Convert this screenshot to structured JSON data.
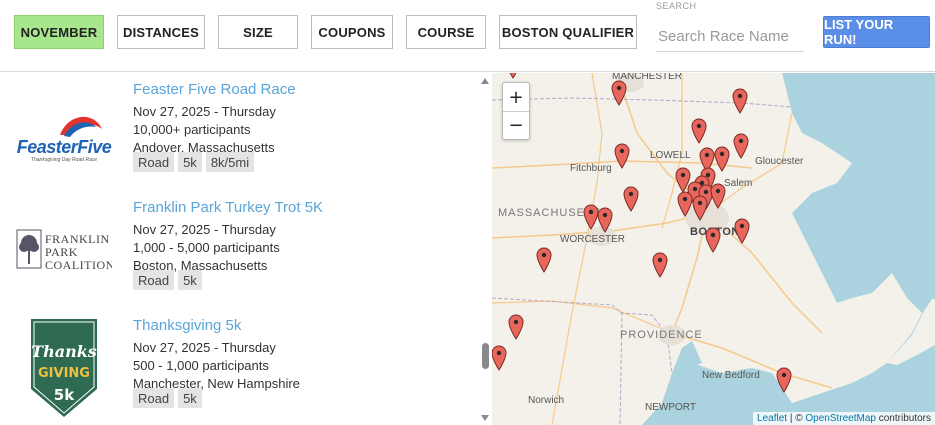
{
  "filters": {
    "november": "NOVEMBER",
    "distances": "DISTANCES",
    "size": "SIZE",
    "coupons": "COUPONS",
    "course": "COURSE",
    "boston_qualifier": "BOSTON QUALIFIER",
    "active_color": "#a8e68e"
  },
  "search": {
    "label": "SEARCH",
    "placeholder": "Search Race Name",
    "value": ""
  },
  "list_button": "LIST YOUR RUN!",
  "races": [
    {
      "name": "Feaster Five Road Race",
      "date": "Nov 27, 2025 - Thursday",
      "participants": "10,000+ participants",
      "location": "Andover, Massachusetts",
      "tags": [
        "Road",
        "5k",
        "8k/5mi"
      ],
      "logo": {
        "main": "FeasterFive",
        "sub": "Thanksgiving Day Road Race"
      }
    },
    {
      "name": "Franklin Park Turkey Trot 5K",
      "date": "Nov 27, 2025 - Thursday",
      "participants": "1,000 - 5,000 participants",
      "location": "Boston, Massachusetts",
      "tags": [
        "Road",
        "5k"
      ],
      "logo": {
        "line1": "FRANKLIN",
        "line2": "PARK",
        "line3": "COALITION"
      }
    },
    {
      "name": "Thanksgiving 5k",
      "date": "Nov 27, 2025 - Thursday",
      "participants": "500 - 1,000 participants",
      "location": "Manchester, New Hampshire",
      "tags": [
        "Road",
        "5k"
      ],
      "logo": {
        "word1": "Thanks",
        "word2": "GIVING",
        "word3": "5k"
      }
    }
  ],
  "map": {
    "zoom_in": "+",
    "zoom_out": "−",
    "labels": {
      "manchester": "MANCHESTER",
      "lowell": "LOWELL",
      "fitchburg": "Fitchburg",
      "gloucester": "Gloucester",
      "salem": "Salem",
      "massachusetts": "MASSACHUSETTS",
      "worcester": "WORCESTER",
      "boston": "BOSTON",
      "providence": "PROVIDENCE",
      "new_bedford": "New Bedford",
      "norwich": "Norwich",
      "newport": "NEWPORT"
    },
    "attribution": {
      "leaflet": "Leaflet",
      "sep": " | © ",
      "osm": "OpenStreetMap",
      "rest": " contributors"
    },
    "pin_color": "#e8665c"
  }
}
